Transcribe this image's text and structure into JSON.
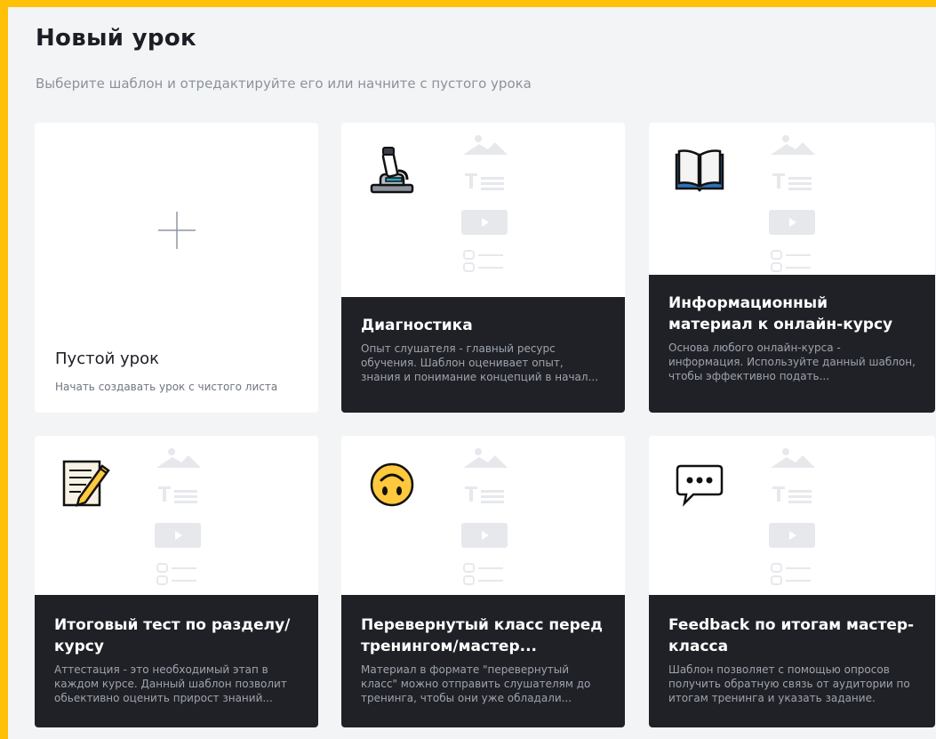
{
  "header": {
    "title": "Новый урок",
    "subtitle": "Выберите шаблон и отредактируйте его или начните с пустого урока"
  },
  "blank_card": {
    "icon": "plus-icon",
    "title": "Пустой урок",
    "description": "Начать создавать урок с чистого листа"
  },
  "templates": [
    {
      "icon": "microscope-icon",
      "title": "Диагностика",
      "description": "Опыт слушателя - главный ресурс обучения. Шаблон оценивает опыт, знания и понимание концепций в начал..."
    },
    {
      "icon": "open-book-icon",
      "title": "Информационный материал к онлайн-курсу",
      "description": "Основа любого онлайн-курса - информация. Используйте данный шаблон, чтобы эффективно подать..."
    },
    {
      "icon": "memo-pencil-icon",
      "title": "Итоговый тест по разделу/курсу",
      "description": "Аттестация - это необходимый этап в каждом курсе. Данный шаблон позволит обьективно оценить прирост знаний..."
    },
    {
      "icon": "upside-down-face-icon",
      "title": "Перевернутый класс перед тренингом/мастер...",
      "description": "Материал в формате \"перевернутый класс\" можно отправить слушателям до тренинга, чтобы они уже обладали..."
    },
    {
      "icon": "speech-bubble-icon",
      "title": "Feedback по итогам мастер-класса",
      "description": "Шаблон позволяет с помощью опросов получить обратную связь от аудитории по итогам тренинга и указать задание."
    }
  ],
  "colors": {
    "accent_border": "#ffc107",
    "background": "#f3f4f6",
    "card_panel": "#1f2127",
    "emoji_yellow": "#ffc83d"
  }
}
